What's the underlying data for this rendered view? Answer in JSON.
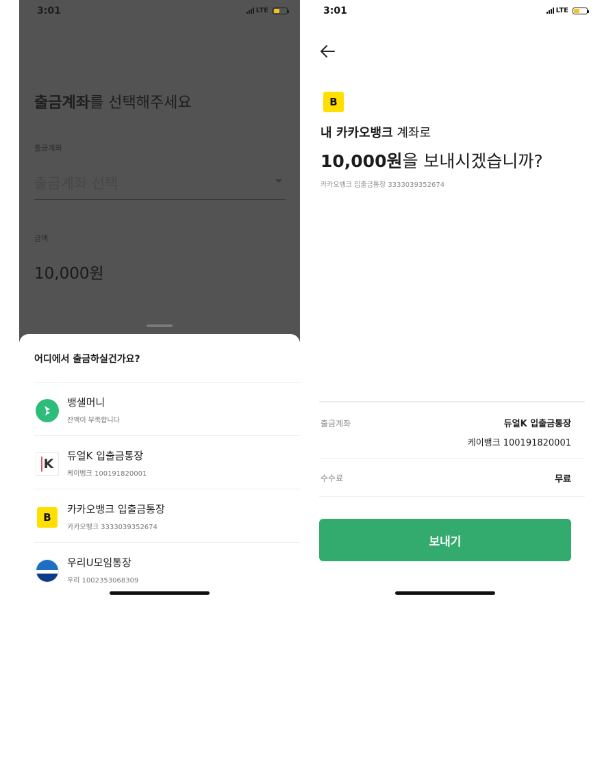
{
  "status_bar": {
    "time": "3:01",
    "network": "LTE"
  },
  "left_screen": {
    "title_bold": "출금계좌",
    "title_rest": "를 선택해주세요",
    "withdraw_field_label": "출금계좌",
    "withdraw_placeholder": "출금계좌 선택",
    "amount_label": "금액",
    "amount_value": "10,000원",
    "sheet_title": "어디에서 출금하실건가요?",
    "accounts": [
      {
        "name": "뱅샐머니",
        "sub": "잔액이 부족합니다",
        "icon": "banksalad-money-logo"
      },
      {
        "name": "듀얼K 입출금통장",
        "sub": "케이뱅크 100191820001",
        "icon": "kbank-logo"
      },
      {
        "name": "카카오뱅크 입출금통장",
        "sub": "카카오뱅크 3333039352674",
        "icon": "kakaobank-logo"
      },
      {
        "name": "우리U모임통장",
        "sub": "우리 1002353068309",
        "icon": "woori-bank-logo"
      }
    ]
  },
  "right_screen": {
    "logo_text": "B",
    "line1_bold": "내 카카오뱅크",
    "line1_rest": " 계좌로",
    "line2_bold": "10,000원",
    "line2_rest": "을 보내시겠습니까?",
    "line3": "카카오뱅크 입출금통장 3333039352674",
    "withdraw_label": "출금계좌",
    "withdraw_name": "듀얼K 입출금통장",
    "withdraw_account": "케이뱅크 100191820001",
    "fee_label": "수수료",
    "fee_value": "무료",
    "send_button": "보내기"
  },
  "colors": {
    "dim_overlay": "#535353",
    "kakao_yellow": "#ffdf00",
    "send_green": "#33ab6f",
    "banksalad_green": "#2ebc7a",
    "battery_yellow": "#f4c21a"
  }
}
